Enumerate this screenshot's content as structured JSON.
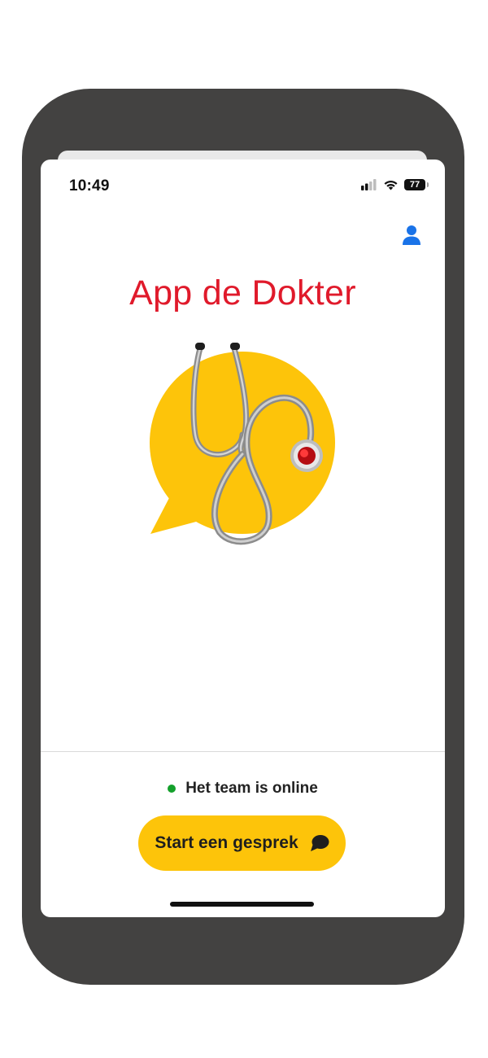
{
  "status_bar": {
    "time": "10:49",
    "battery": "77",
    "icons": [
      "signal-icon",
      "wifi-icon",
      "battery-icon"
    ]
  },
  "header": {
    "profile_icon": "user-icon"
  },
  "main": {
    "title": "App de Dokter",
    "logo_icon": "stethoscope-chat-bubble-logo"
  },
  "footer": {
    "status_text": "Het team is online",
    "start_button_label": "Start een gesprek",
    "start_button_icon": "chat-bubble-icon"
  },
  "colors": {
    "device_frame": "#434241",
    "title_red": "#e01a2b",
    "accent_yellow": "#fdc40a",
    "online_green": "#14a02b",
    "profile_blue": "#1a73e8"
  }
}
